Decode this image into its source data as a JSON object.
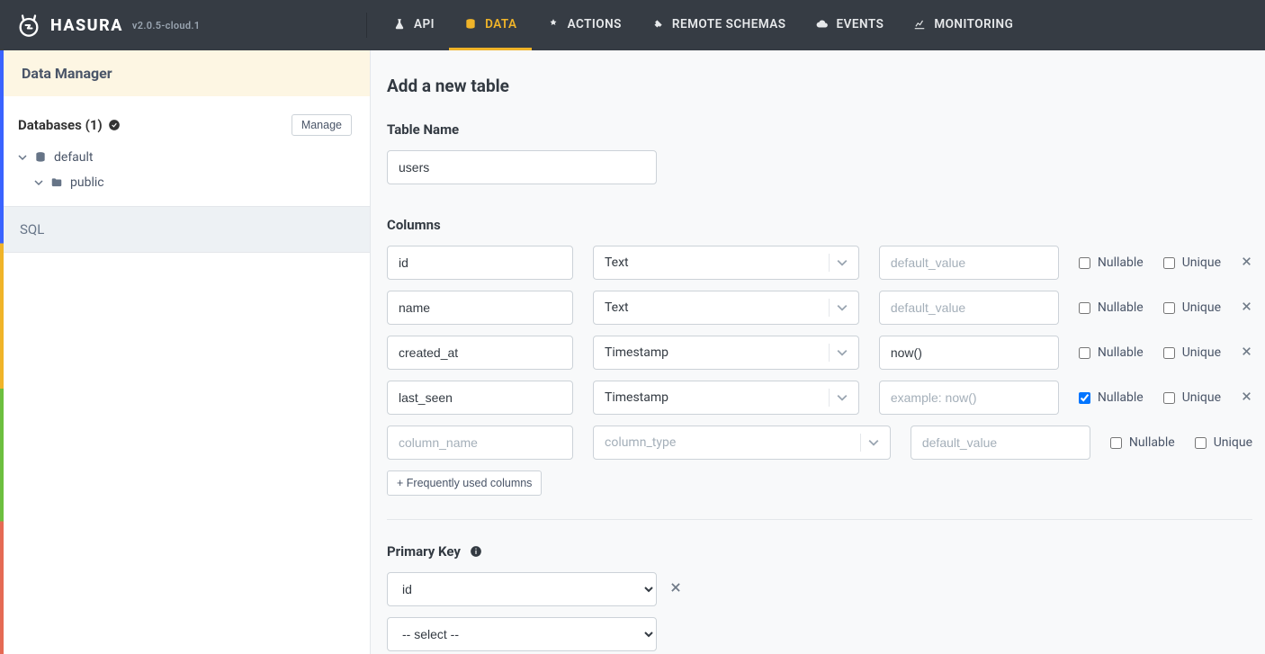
{
  "brand": {
    "name": "HASURA",
    "version": "v2.0.5-cloud.1"
  },
  "topnav": {
    "api": "API",
    "data": "DATA",
    "actions": "ACTIONS",
    "remote_schemas": "REMOTE SCHEMAS",
    "events": "EVENTS",
    "monitoring": "MONITORING"
  },
  "sidebar": {
    "title": "Data Manager",
    "databases_label": "Databases (1)",
    "manage_label": "Manage",
    "tree_default": "default",
    "tree_public": "public",
    "sql_label": "SQL"
  },
  "page": {
    "title": "Add a new table",
    "table_name_label": "Table Name",
    "table_name_value": "users",
    "columns_label": "Columns",
    "nullable_label": "Nullable",
    "unique_label": "Unique",
    "freq_button": "+ Frequently used columns",
    "primary_key_label": "Primary Key",
    "pk_value": "id",
    "pk_placeholder": "-- select --",
    "placeholders": {
      "column_name": "column_name",
      "column_type": "column_type",
      "default_value": "default_value",
      "example_now": "example: now()"
    },
    "columns": [
      {
        "name": "id",
        "type": "Text",
        "default": "",
        "default_placeholder": "default_value",
        "nullable": false,
        "unique": false,
        "removable": true
      },
      {
        "name": "name",
        "type": "Text",
        "default": "",
        "default_placeholder": "default_value",
        "nullable": false,
        "unique": false,
        "removable": true
      },
      {
        "name": "created_at",
        "type": "Timestamp",
        "default": "now()",
        "default_placeholder": "default_value",
        "nullable": false,
        "unique": false,
        "removable": true
      },
      {
        "name": "last_seen",
        "type": "Timestamp",
        "default": "",
        "default_placeholder": "example: now()",
        "nullable": true,
        "unique": false,
        "removable": true
      },
      {
        "name": "",
        "type": "",
        "default": "",
        "default_placeholder": "default_value",
        "nullable": false,
        "unique": false,
        "removable": false
      }
    ]
  }
}
